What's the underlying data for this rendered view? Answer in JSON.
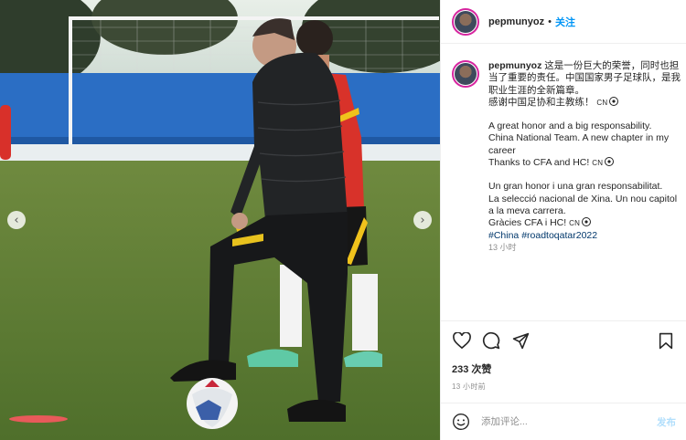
{
  "header": {
    "username": "pepmunyoz",
    "separator": "•",
    "follow_label": "关注"
  },
  "caption": {
    "username": "pepmunyoz",
    "zh_line": "这是一份巨大的荣誉，同时也担当了重要的责任。中国国家男子足球队，是我职业生涯的全新篇章。",
    "zh_thanks": "感谢中国足协和主教练！",
    "en_lines": [
      "A great honor and a big responsability.",
      "China National Team. A new chapter in my career",
      "Thanks to CFA and HC!"
    ],
    "ca_lines": [
      "Un gran honor i una gran responsabilitat.",
      "La selecció nacional de Xina. Un nou capitol a la meva carrera.",
      "Gràcies CFA i HC!"
    ],
    "flag_label": "CN",
    "tags": "#China #roadtoqatar2022",
    "time_short": "13 小时"
  },
  "actions": {
    "like_icon": "heart-icon",
    "comment_icon": "comment-icon",
    "share_icon": "share-icon",
    "save_icon": "bookmark-icon",
    "likes_text": "233 次赞",
    "time_ago": "13 小时前"
  },
  "comment": {
    "placeholder": "添加评论...",
    "post_label": "发布"
  },
  "photo": {
    "prev_icon": "chevron-left-icon",
    "next_icon": "chevron-right-icon",
    "carousel_dots": 3,
    "active_dot": 0
  },
  "colors": {
    "accent": "#0095f6",
    "post_disabled": "#b2dffc",
    "hashtag": "#00376b",
    "muted": "#8e8e8e"
  }
}
